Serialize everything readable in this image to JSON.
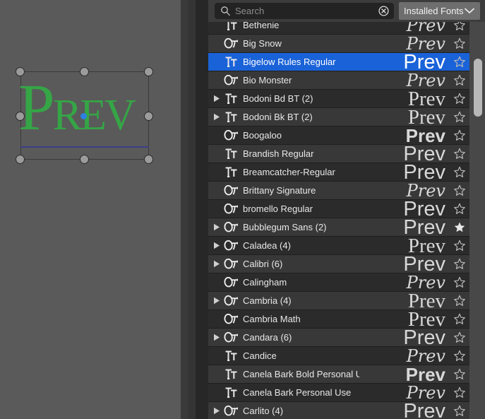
{
  "canvas": {
    "artwork_text": "PREV",
    "artwork_color": "#35a546",
    "baseline_color": "#3c3f86",
    "background_color": "#5a5a5a",
    "handle_color": "#9b9b9b",
    "pivot_color": "#2d7fe0"
  },
  "toolbar": {
    "search_placeholder": "Search",
    "search_value": "",
    "search_icon": "magnifier-icon",
    "clear_icon": "clear-search-icon",
    "filter_label": "Installed Fonts",
    "filter_chevron_icon": "chevron-down-icon"
  },
  "panel": {
    "selected_row_color": "#1a62d8",
    "row_odd_color": "#2b2b2b",
    "row_even_color": "#383838"
  },
  "fonts": [
    {
      "name": "Bethenie",
      "type": "TT",
      "expandable": false,
      "favorite": false,
      "selected": false,
      "preview": "Prev",
      "preview_style": "pv-script",
      "clipped_top": true
    },
    {
      "name": "Big Snow",
      "type": "OT",
      "expandable": false,
      "favorite": false,
      "selected": false,
      "preview": "Prev",
      "preview_style": "pv-script"
    },
    {
      "name": "Bigelow Rules Regular",
      "type": "TT",
      "expandable": false,
      "favorite": false,
      "selected": true,
      "preview": "Prev",
      "preview_style": "pv-sans"
    },
    {
      "name": "Bio Monster",
      "type": "OT",
      "expandable": false,
      "favorite": false,
      "selected": false,
      "preview": "Prev",
      "preview_style": "pv-script"
    },
    {
      "name": "Bodoni Bd BT (2)",
      "type": "TT",
      "expandable": true,
      "favorite": false,
      "selected": false,
      "preview": "Prev",
      "preview_style": "pv-serif"
    },
    {
      "name": "Bodoni Bk BT (2)",
      "type": "TT",
      "expandable": true,
      "favorite": false,
      "selected": false,
      "preview": "Prev",
      "preview_style": "pv-serif"
    },
    {
      "name": "Boogaloo",
      "type": "OT",
      "expandable": false,
      "favorite": false,
      "selected": false,
      "preview": "Prev",
      "preview_style": "pv-bold"
    },
    {
      "name": "Brandish Regular",
      "type": "TT",
      "expandable": false,
      "favorite": false,
      "selected": false,
      "preview": "Prev",
      "preview_style": "pv-sans"
    },
    {
      "name": "Breamcatcher-Regular",
      "type": "TT",
      "expandable": false,
      "favorite": false,
      "selected": false,
      "preview": "Prev",
      "preview_style": "pv-sans"
    },
    {
      "name": "Brittany Signature",
      "type": "OT",
      "expandable": false,
      "favorite": false,
      "selected": false,
      "preview": "Prev",
      "preview_style": "pv-script"
    },
    {
      "name": "bromello Regular",
      "type": "OT",
      "expandable": false,
      "favorite": false,
      "selected": false,
      "preview": "Prev",
      "preview_style": "pv-sans"
    },
    {
      "name": "Bubblegum Sans (2)",
      "type": "OT",
      "expandable": true,
      "favorite": true,
      "selected": false,
      "preview": "Prev",
      "preview_style": "pv-sans"
    },
    {
      "name": "Caladea (4)",
      "type": "OT",
      "expandable": true,
      "favorite": false,
      "selected": false,
      "preview": "Prev",
      "preview_style": "pv-serif"
    },
    {
      "name": "Calibri (6)",
      "type": "OT",
      "expandable": true,
      "favorite": false,
      "selected": false,
      "preview": "Prev",
      "preview_style": "pv-sans"
    },
    {
      "name": "Calingham",
      "type": "OT",
      "expandable": false,
      "favorite": false,
      "selected": false,
      "preview": "Prev",
      "preview_style": "pv-script"
    },
    {
      "name": "Cambria (4)",
      "type": "OT",
      "expandable": true,
      "favorite": false,
      "selected": false,
      "preview": "Prev",
      "preview_style": "pv-serif"
    },
    {
      "name": "Cambria Math",
      "type": "OT",
      "expandable": false,
      "favorite": false,
      "selected": false,
      "preview": "Prev",
      "preview_style": "pv-serif"
    },
    {
      "name": "Candara (6)",
      "type": "OT",
      "expandable": true,
      "favorite": false,
      "selected": false,
      "preview": "Prev",
      "preview_style": "pv-sans"
    },
    {
      "name": "Candice",
      "type": "TT",
      "expandable": false,
      "favorite": false,
      "selected": false,
      "preview": "Prev",
      "preview_style": "pv-script"
    },
    {
      "name": "Canela Bark Bold Personal Use",
      "type": "TT",
      "expandable": false,
      "favorite": false,
      "selected": false,
      "preview": "Prev",
      "preview_style": "pv-bold"
    },
    {
      "name": "Canela Bark Personal Use",
      "type": "TT",
      "expandable": false,
      "favorite": false,
      "selected": false,
      "preview": "Prev",
      "preview_style": "pv-script"
    },
    {
      "name": "Carlito (4)",
      "type": "OT",
      "expandable": true,
      "favorite": false,
      "selected": false,
      "preview": "Prev",
      "preview_style": "pv-sans"
    }
  ]
}
